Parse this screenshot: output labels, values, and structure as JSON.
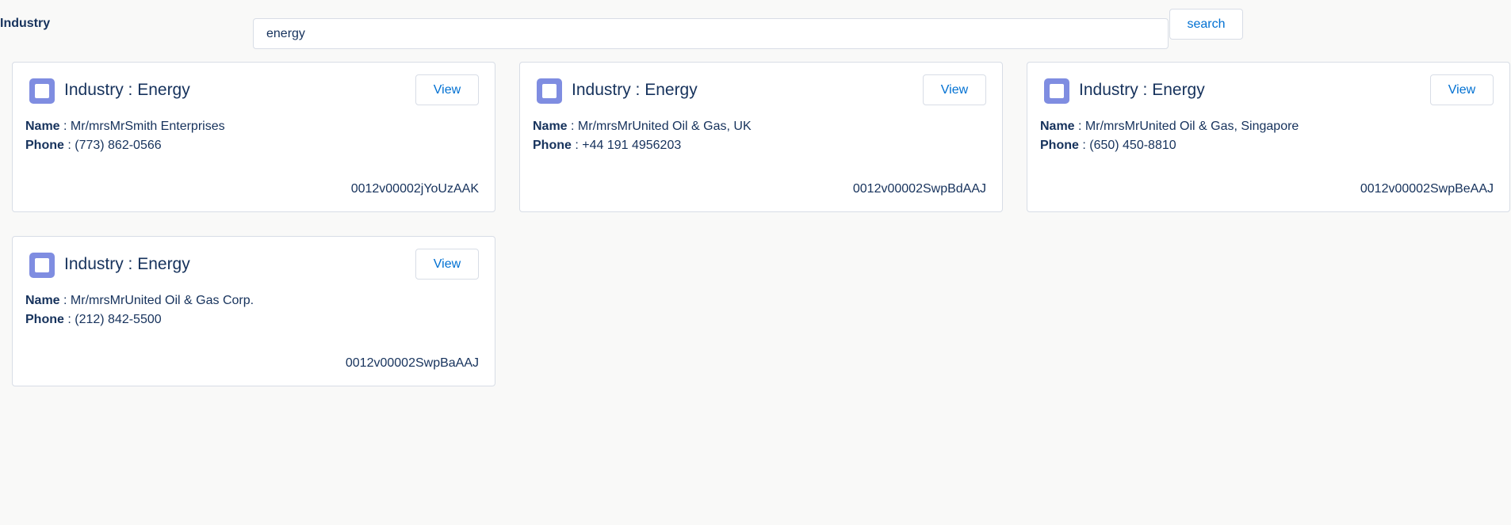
{
  "search": {
    "label": "Industry",
    "value": "energy",
    "button_label": "search"
  },
  "labels": {
    "name_key": "Name",
    "phone_key": "Phone",
    "separator": " : ",
    "view_label": "View"
  },
  "colors": {
    "accent": "#0070d2",
    "text": "#16325c",
    "icon_bg": "#7f8de1",
    "border": "#d8dde6",
    "page_bg": "#f9f9f8"
  },
  "cards": [
    {
      "title": "Industry : Energy",
      "name": "Mr/mrsMrSmith Enterprises",
      "phone": "(773) 862-0566",
      "record_id": "0012v00002jYoUzAAK",
      "icon": "account-icon"
    },
    {
      "title": "Industry : Energy",
      "name": "Mr/mrsMrUnited Oil & Gas, UK",
      "phone": "+44 191 4956203",
      "record_id": "0012v00002SwpBdAAJ",
      "icon": "account-icon"
    },
    {
      "title": "Industry : Energy",
      "name": "Mr/mrsMrUnited Oil & Gas, Singapore",
      "phone": "(650) 450-8810",
      "record_id": "0012v00002SwpBeAAJ",
      "icon": "account-icon"
    },
    {
      "title": "Industry : Energy",
      "name": "Mr/mrsMrUnited Oil & Gas Corp.",
      "phone": "(212) 842-5500",
      "record_id": "0012v00002SwpBaAAJ",
      "icon": "account-icon"
    }
  ]
}
